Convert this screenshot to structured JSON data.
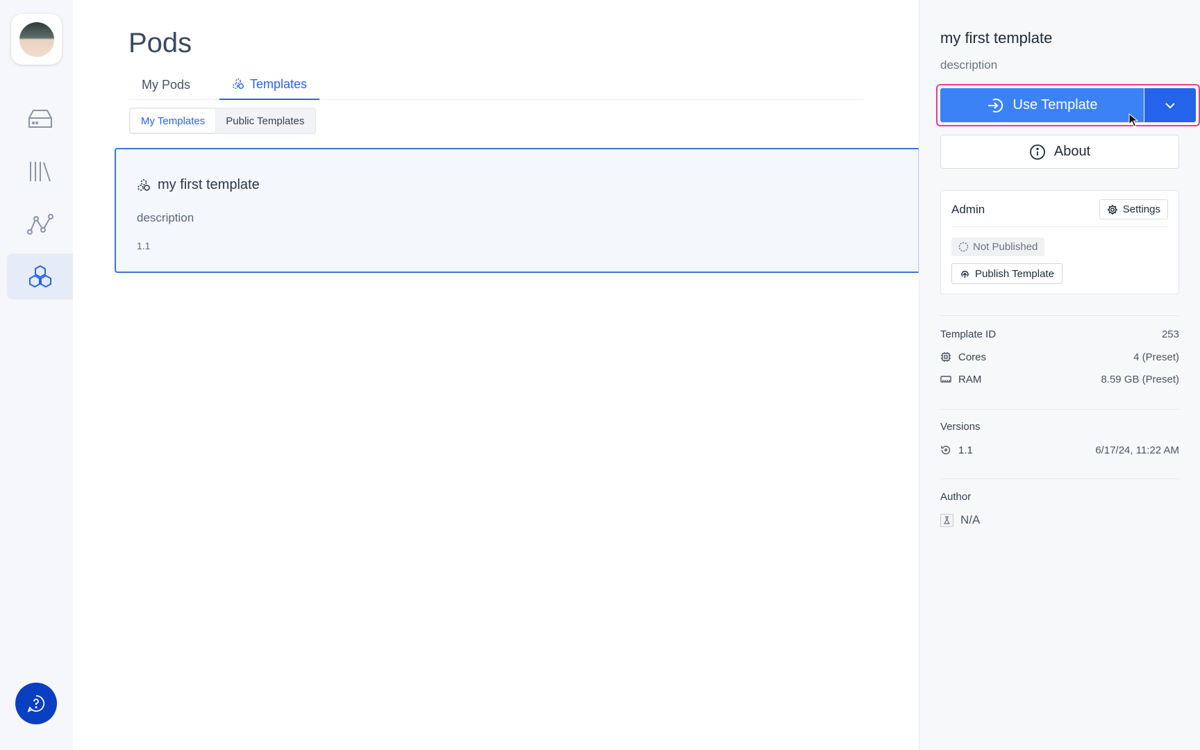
{
  "sidebar": {
    "items": [
      {
        "icon": "drive-icon"
      },
      {
        "icon": "library-icon"
      },
      {
        "icon": "graph-icon"
      },
      {
        "icon": "hexagons-icon",
        "active": true
      }
    ],
    "help_icon": "help-chat-icon"
  },
  "main": {
    "title": "Pods",
    "tabs": [
      {
        "label": "My Pods",
        "active": false
      },
      {
        "label": "Templates",
        "active": true
      }
    ],
    "segments": [
      {
        "label": "My Templates",
        "active": true
      },
      {
        "label": "Public Templates",
        "active": false
      }
    ],
    "card": {
      "title": "my first template",
      "description": "description",
      "version": "1.1"
    }
  },
  "panel": {
    "title": "my first template",
    "description": "description",
    "use_button": "Use Template",
    "about_button": "About",
    "admin": {
      "label": "Admin",
      "settings": "Settings",
      "status": "Not Published",
      "publish": "Publish Template"
    },
    "details": {
      "template_id_label": "Template ID",
      "template_id": "253",
      "cores_label": "Cores",
      "cores": "4 (Preset)",
      "ram_label": "RAM",
      "ram": "8.59 GB (Preset)"
    },
    "versions": {
      "label": "Versions",
      "items": [
        {
          "version": "1.1",
          "date": "6/17/24, 11:22 AM"
        }
      ]
    },
    "author": {
      "label": "Author",
      "value": "N/A"
    }
  },
  "colors": {
    "accent": "#2563eb",
    "primary_button": "#3b82f6",
    "help_button": "#0b3fc2",
    "focus_ring": "#e8399a"
  }
}
